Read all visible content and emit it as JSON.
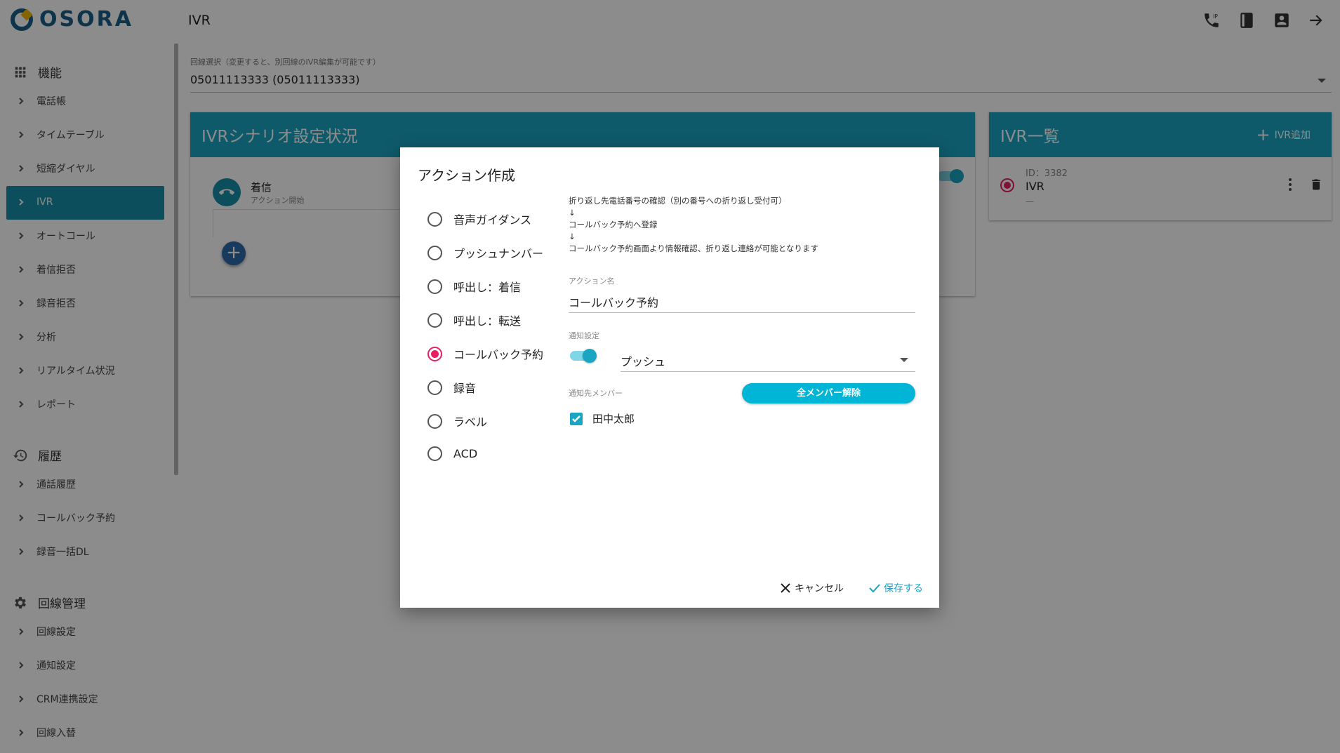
{
  "app": {
    "logo_text": "OSORA",
    "page_title": "IVR"
  },
  "header_icons": [
    "phone-icon",
    "book-icon",
    "contact-icon",
    "logout-icon"
  ],
  "sidebar": {
    "sections": [
      {
        "label": "機能",
        "icon": "grid-icon"
      },
      {
        "label": "履歴",
        "icon": "history-icon"
      },
      {
        "label": "回線管理",
        "icon": "gear-icon"
      }
    ],
    "features": [
      "電話帳",
      "タイムテーブル",
      "短縮ダイヤル",
      "IVR",
      "オートコール",
      "着信拒否",
      "録音拒否",
      "分析",
      "リアルタイム状況",
      "レポート"
    ],
    "history": [
      "通話履歴",
      "コールバック予約",
      "録音一括DL"
    ],
    "line_mgmt": [
      "回線設定",
      "通知設定",
      "CRM連携設定",
      "回線入替"
    ],
    "active": "IVR"
  },
  "line_select": {
    "label": "回線選択（変更すると、別回線のIVR編集が可能です）",
    "value": "05011113333 (05011113333)"
  },
  "scenario_panel": {
    "title": "IVRシナリオ設定状況",
    "node_title": "着信",
    "node_sub": "アクション開始",
    "add_label": "+"
  },
  "ivr_list": {
    "title": "IVR一覧",
    "add_label": "IVR追加",
    "items": [
      {
        "id": "ID：3382",
        "name": "IVR",
        "desc": "—"
      }
    ]
  },
  "dialog": {
    "title": "アクション作成",
    "options": [
      "音声ガイダンス",
      "プッシュナンバー",
      "呼出し：着信",
      "呼出し：転送",
      "コールバック予約",
      "録音",
      "ラベル",
      "ACD"
    ],
    "selected_option": "コールバック予約",
    "description": {
      "line1": "折り返し先電話番号の確認（別の番号への折り返し受付可）",
      "arrow1": "↓",
      "line2": "コールバック予約へ登録",
      "arrow2": "↓",
      "line3": "コールバック予約画面より情報確認、折り返し連絡が可能となります"
    },
    "action_name_label": "アクション名",
    "action_name_value": "コールバック予約",
    "notify_label": "通知設定",
    "notify_enabled": true,
    "notify_method": "プッシュ",
    "members_label": "通知先メンバー",
    "release_all_label": "全メンバー解除",
    "members": [
      {
        "name": "田中太郎",
        "checked": true
      }
    ],
    "cancel_label": "キャンセル",
    "save_label": "保存する"
  },
  "colors": {
    "accent": "#1aa5c3",
    "active_nav": "#178fa8",
    "radio_selected": "#e91e63",
    "fab": "#2c6aa8"
  }
}
